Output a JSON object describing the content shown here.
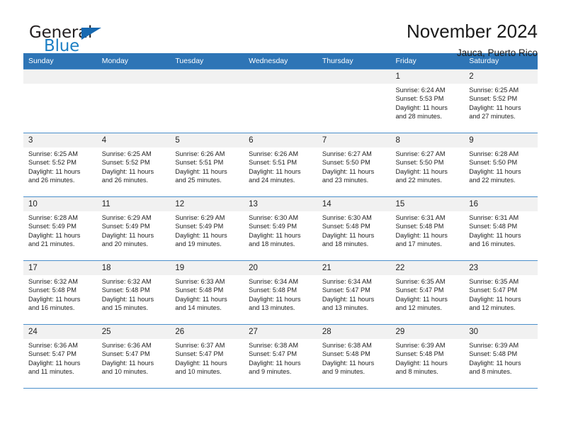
{
  "brand": {
    "name_part1": "General",
    "name_part2": "Blue",
    "triangle_color": "#1668b0",
    "blue_color": "#1c7fc4"
  },
  "header": {
    "title": "November 2024",
    "location": "Jauca, Puerto Rico",
    "header_bg": "#2e75b6",
    "grid_line_color": "#4b8fcb",
    "daynum_bg": "#f1f1f1"
  },
  "weekdays": [
    "Sunday",
    "Monday",
    "Tuesday",
    "Wednesday",
    "Thursday",
    "Friday",
    "Saturday"
  ],
  "labels": {
    "sunrise_prefix": "Sunrise:",
    "sunset_prefix": "Sunset:",
    "daylight_prefix": "Daylight:"
  },
  "weeks": [
    [
      {
        "day": "",
        "line1": "",
        "line2": "",
        "line3": "",
        "line4": ""
      },
      {
        "day": "",
        "line1": "",
        "line2": "",
        "line3": "",
        "line4": ""
      },
      {
        "day": "",
        "line1": "",
        "line2": "",
        "line3": "",
        "line4": ""
      },
      {
        "day": "",
        "line1": "",
        "line2": "",
        "line3": "",
        "line4": ""
      },
      {
        "day": "",
        "line1": "",
        "line2": "",
        "line3": "",
        "line4": ""
      },
      {
        "day": "1",
        "line1": "Sunrise: 6:24 AM",
        "line2": "Sunset: 5:53 PM",
        "line3": "Daylight: 11 hours",
        "line4": "and 28 minutes."
      },
      {
        "day": "2",
        "line1": "Sunrise: 6:25 AM",
        "line2": "Sunset: 5:52 PM",
        "line3": "Daylight: 11 hours",
        "line4": "and 27 minutes."
      }
    ],
    [
      {
        "day": "3",
        "line1": "Sunrise: 6:25 AM",
        "line2": "Sunset: 5:52 PM",
        "line3": "Daylight: 11 hours",
        "line4": "and 26 minutes."
      },
      {
        "day": "4",
        "line1": "Sunrise: 6:25 AM",
        "line2": "Sunset: 5:52 PM",
        "line3": "Daylight: 11 hours",
        "line4": "and 26 minutes."
      },
      {
        "day": "5",
        "line1": "Sunrise: 6:26 AM",
        "line2": "Sunset: 5:51 PM",
        "line3": "Daylight: 11 hours",
        "line4": "and 25 minutes."
      },
      {
        "day": "6",
        "line1": "Sunrise: 6:26 AM",
        "line2": "Sunset: 5:51 PM",
        "line3": "Daylight: 11 hours",
        "line4": "and 24 minutes."
      },
      {
        "day": "7",
        "line1": "Sunrise: 6:27 AM",
        "line2": "Sunset: 5:50 PM",
        "line3": "Daylight: 11 hours",
        "line4": "and 23 minutes."
      },
      {
        "day": "8",
        "line1": "Sunrise: 6:27 AM",
        "line2": "Sunset: 5:50 PM",
        "line3": "Daylight: 11 hours",
        "line4": "and 22 minutes."
      },
      {
        "day": "9",
        "line1": "Sunrise: 6:28 AM",
        "line2": "Sunset: 5:50 PM",
        "line3": "Daylight: 11 hours",
        "line4": "and 22 minutes."
      }
    ],
    [
      {
        "day": "10",
        "line1": "Sunrise: 6:28 AM",
        "line2": "Sunset: 5:49 PM",
        "line3": "Daylight: 11 hours",
        "line4": "and 21 minutes."
      },
      {
        "day": "11",
        "line1": "Sunrise: 6:29 AM",
        "line2": "Sunset: 5:49 PM",
        "line3": "Daylight: 11 hours",
        "line4": "and 20 minutes."
      },
      {
        "day": "12",
        "line1": "Sunrise: 6:29 AM",
        "line2": "Sunset: 5:49 PM",
        "line3": "Daylight: 11 hours",
        "line4": "and 19 minutes."
      },
      {
        "day": "13",
        "line1": "Sunrise: 6:30 AM",
        "line2": "Sunset: 5:49 PM",
        "line3": "Daylight: 11 hours",
        "line4": "and 18 minutes."
      },
      {
        "day": "14",
        "line1": "Sunrise: 6:30 AM",
        "line2": "Sunset: 5:48 PM",
        "line3": "Daylight: 11 hours",
        "line4": "and 18 minutes."
      },
      {
        "day": "15",
        "line1": "Sunrise: 6:31 AM",
        "line2": "Sunset: 5:48 PM",
        "line3": "Daylight: 11 hours",
        "line4": "and 17 minutes."
      },
      {
        "day": "16",
        "line1": "Sunrise: 6:31 AM",
        "line2": "Sunset: 5:48 PM",
        "line3": "Daylight: 11 hours",
        "line4": "and 16 minutes."
      }
    ],
    [
      {
        "day": "17",
        "line1": "Sunrise: 6:32 AM",
        "line2": "Sunset: 5:48 PM",
        "line3": "Daylight: 11 hours",
        "line4": "and 16 minutes."
      },
      {
        "day": "18",
        "line1": "Sunrise: 6:32 AM",
        "line2": "Sunset: 5:48 PM",
        "line3": "Daylight: 11 hours",
        "line4": "and 15 minutes."
      },
      {
        "day": "19",
        "line1": "Sunrise: 6:33 AM",
        "line2": "Sunset: 5:48 PM",
        "line3": "Daylight: 11 hours",
        "line4": "and 14 minutes."
      },
      {
        "day": "20",
        "line1": "Sunrise: 6:34 AM",
        "line2": "Sunset: 5:48 PM",
        "line3": "Daylight: 11 hours",
        "line4": "and 13 minutes."
      },
      {
        "day": "21",
        "line1": "Sunrise: 6:34 AM",
        "line2": "Sunset: 5:47 PM",
        "line3": "Daylight: 11 hours",
        "line4": "and 13 minutes."
      },
      {
        "day": "22",
        "line1": "Sunrise: 6:35 AM",
        "line2": "Sunset: 5:47 PM",
        "line3": "Daylight: 11 hours",
        "line4": "and 12 minutes."
      },
      {
        "day": "23",
        "line1": "Sunrise: 6:35 AM",
        "line2": "Sunset: 5:47 PM",
        "line3": "Daylight: 11 hours",
        "line4": "and 12 minutes."
      }
    ],
    [
      {
        "day": "24",
        "line1": "Sunrise: 6:36 AM",
        "line2": "Sunset: 5:47 PM",
        "line3": "Daylight: 11 hours",
        "line4": "and 11 minutes."
      },
      {
        "day": "25",
        "line1": "Sunrise: 6:36 AM",
        "line2": "Sunset: 5:47 PM",
        "line3": "Daylight: 11 hours",
        "line4": "and 10 minutes."
      },
      {
        "day": "26",
        "line1": "Sunrise: 6:37 AM",
        "line2": "Sunset: 5:47 PM",
        "line3": "Daylight: 11 hours",
        "line4": "and 10 minutes."
      },
      {
        "day": "27",
        "line1": "Sunrise: 6:38 AM",
        "line2": "Sunset: 5:47 PM",
        "line3": "Daylight: 11 hours",
        "line4": "and 9 minutes."
      },
      {
        "day": "28",
        "line1": "Sunrise: 6:38 AM",
        "line2": "Sunset: 5:48 PM",
        "line3": "Daylight: 11 hours",
        "line4": "and 9 minutes."
      },
      {
        "day": "29",
        "line1": "Sunrise: 6:39 AM",
        "line2": "Sunset: 5:48 PM",
        "line3": "Daylight: 11 hours",
        "line4": "and 8 minutes."
      },
      {
        "day": "30",
        "line1": "Sunrise: 6:39 AM",
        "line2": "Sunset: 5:48 PM",
        "line3": "Daylight: 11 hours",
        "line4": "and 8 minutes."
      }
    ]
  ]
}
